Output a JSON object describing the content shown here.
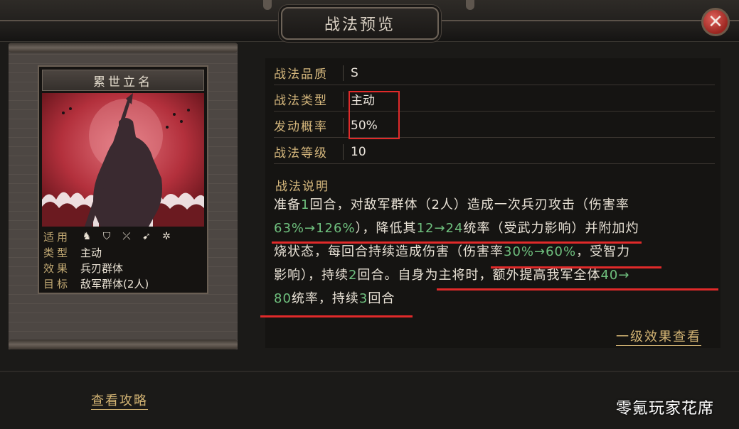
{
  "window": {
    "title": "战法预览",
    "close_icon": "close-icon"
  },
  "card": {
    "name": "累世立名",
    "stats": [
      {
        "key": "适用",
        "icons": [
          "cavalry-icon",
          "shield-icon",
          "bow-icon",
          "spear-icon",
          "wheel-icon"
        ]
      },
      {
        "key": "类型",
        "value": "主动"
      },
      {
        "key": "效果",
        "value": "兵刃群体"
      },
      {
        "key": "目标",
        "value": "敌军群体(2人)"
      }
    ]
  },
  "attributes": [
    {
      "key": "战法品质",
      "value": "S"
    },
    {
      "key": "战法类型",
      "value": "主动"
    },
    {
      "key": "发动概率",
      "value": "50%"
    },
    {
      "key": "战法等级",
      "value": "10"
    }
  ],
  "description": {
    "title": "战法说明",
    "lines": [
      [
        {
          "t": "准备"
        },
        {
          "t": "1",
          "g": true
        },
        {
          "t": "回合，对敌军群体（2人）造成一次兵刃攻击（伤害率"
        }
      ],
      [
        {
          "t": "63%→126%",
          "g": true
        },
        {
          "t": "），降低其"
        },
        {
          "t": "12→24",
          "g": true
        },
        {
          "t": "统率（受武力影响）并附加灼"
        }
      ],
      [
        {
          "t": "烧状态，每回合持续造成伤害（伤害率"
        },
        {
          "t": "30%→60%",
          "g": true
        },
        {
          "t": "，受智力"
        }
      ],
      [
        {
          "t": "影响），持续"
        },
        {
          "t": "2",
          "g": true
        },
        {
          "t": "回合。自身为主将时，额外提高我军全体"
        },
        {
          "t": "40→",
          "g": true
        }
      ],
      [
        {
          "t": "80",
          "g": true
        },
        {
          "t": "统率，持续"
        },
        {
          "t": "3",
          "g": true
        },
        {
          "t": "回合"
        }
      ]
    ]
  },
  "links": {
    "level_effect": "一级效果查看",
    "strategy_guide": "查看攻略"
  },
  "watermark": "零氪玩家花席",
  "colors": {
    "highlight_green": "#6fc07e",
    "label_gold": "#d6b87d",
    "annotation_red": "#e02a2a"
  }
}
